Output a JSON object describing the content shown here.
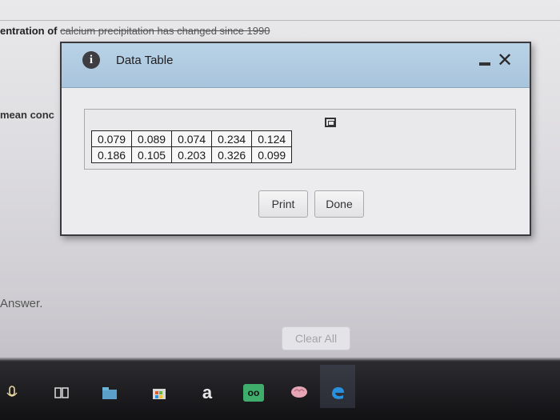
{
  "background": {
    "top_text_prefix": "entration of ",
    "top_text_struck": "calcium precipitation has changed since 1990",
    "mean_text": "mean conc",
    "answer_text": "Answer.",
    "clear_all_label": "Clear All"
  },
  "dialog": {
    "icon": "info-icon",
    "title": "Data Table",
    "table": {
      "rows": [
        [
          "0.079",
          "0.089",
          "0.074",
          "0.234",
          "0.124"
        ],
        [
          "0.186",
          "0.105",
          "0.203",
          "0.326",
          "0.099"
        ]
      ]
    },
    "print_label": "Print",
    "done_label": "Done"
  },
  "taskbar": {
    "amazon_glyph": "a",
    "tripadvisor_glyph": "oo"
  },
  "colors": {
    "titlebar": "#b9d2e6",
    "dialog_bg": "#ececee",
    "taskbar": "#151518"
  }
}
